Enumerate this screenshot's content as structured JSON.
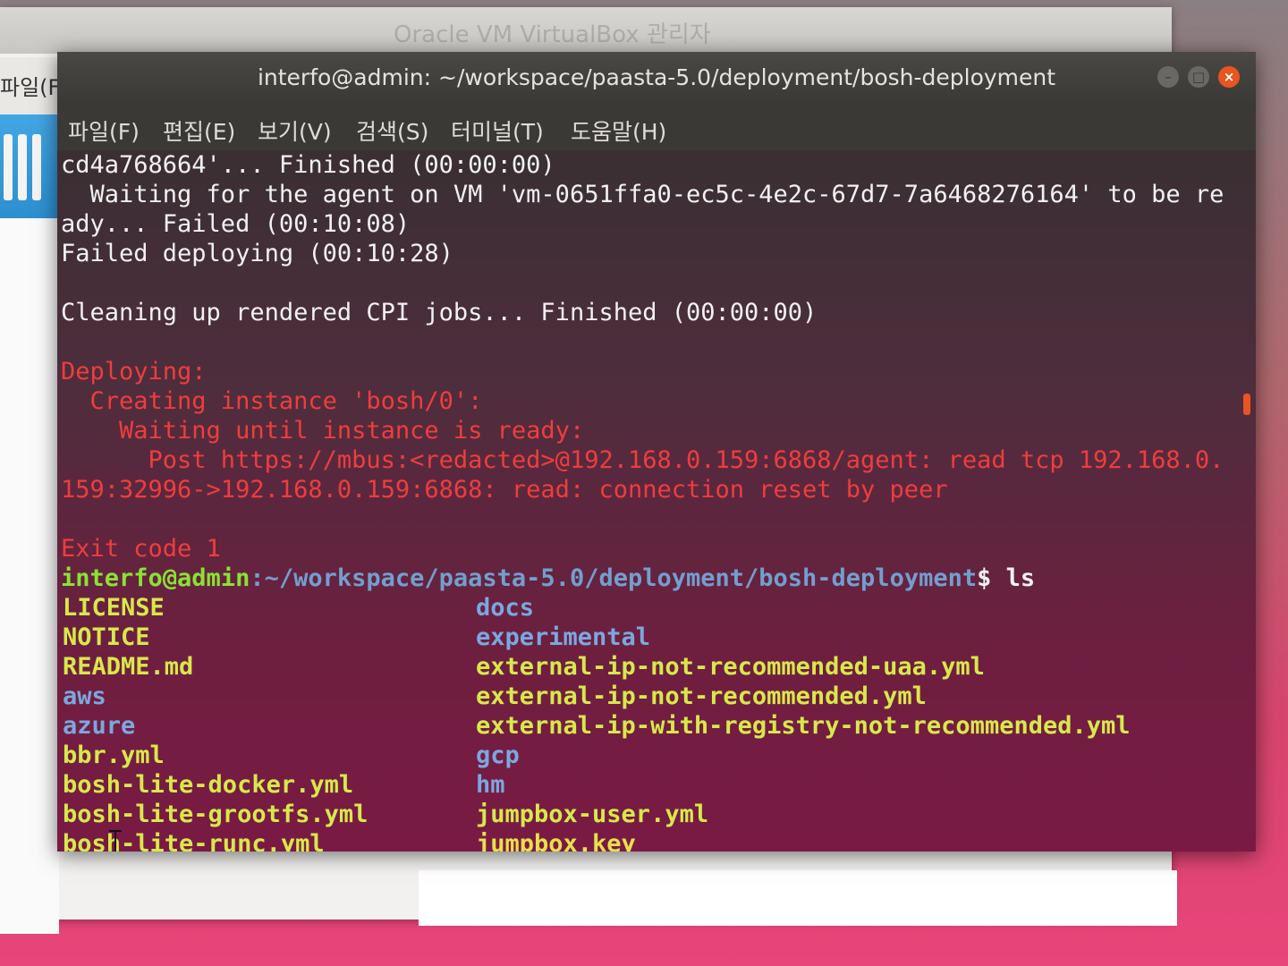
{
  "background_window": {
    "title": "Oracle VM VirtualBox 관리자",
    "menu_label": "파일(F)"
  },
  "terminal": {
    "title": "interfo@admin: ~/workspace/paasta-5.0/deployment/bosh-deployment",
    "menu": [
      "파일(F)",
      "편집(E)",
      "보기(V)",
      "검색(S)",
      "터미널(T)",
      "도움말(H)"
    ],
    "output": [
      "cd4a768664'... Finished (00:00:00)",
      "  Waiting for the agent on VM 'vm-0651ffa0-ec5c-4e2c-67d7-7a6468276164' to be re",
      "ady... Failed (00:10:08)",
      "Failed deploying (00:10:28)",
      "",
      "Cleaning up rendered CPI jobs... Finished (00:00:00)",
      "",
      "Deploying:",
      "  Creating instance 'bosh/0':",
      "    Waiting until instance is ready:",
      "      Post https://mbus:<redacted>@192.168.0.159:6868/agent: read tcp 192.168.0.",
      "159:32996->192.168.0.159:6868: read: connection reset by peer",
      "",
      "Exit code 1"
    ],
    "prompt_user": "interfo@admin",
    "prompt_path": ":~/workspace/paasta-5.0/deployment/bosh-deployment",
    "prompt_cmd": "$ ls",
    "ls_left": [
      "LICENSE",
      "NOTICE",
      "README.md",
      "aws",
      "azure",
      "bbr.yml",
      "bosh-lite-docker.yml",
      "bosh-lite-grootfs.yml",
      "bosh-lite-runc.yml"
    ],
    "ls_right": [
      "docs",
      "experimental",
      "external-ip-not-recommended-uaa.yml",
      "external-ip-not-recommended.yml",
      "external-ip-with-registry-not-recommended.yml",
      "gcp",
      "hm",
      "jumpbox-user.yml",
      "jumpbox.key"
    ]
  },
  "colors": {
    "error": "#ef3d3d",
    "prompt": "#8ae234",
    "path": "#729fcf",
    "file": "#d8e84a",
    "directory": "#7aa8e0"
  }
}
